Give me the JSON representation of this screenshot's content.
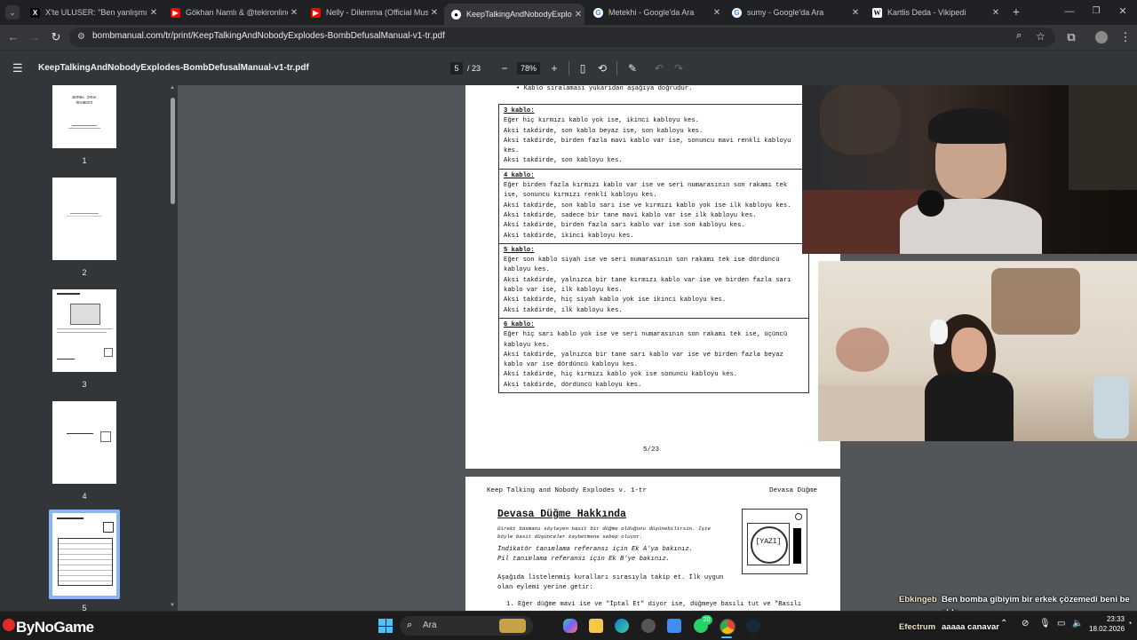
{
  "browser": {
    "tabs": [
      {
        "title": "X'te ULUSER: \"Ben yanlışmı duy",
        "icon": "x-icon",
        "active": false
      },
      {
        "title": "Gökhan Namlı & @tekironline",
        "icon": "youtube-icon",
        "active": false
      },
      {
        "title": "Nelly - Dilemma (Official Music",
        "icon": "youtube-icon",
        "active": false
      },
      {
        "title": "KeepTalkingAndNobodyExplod",
        "icon": "bombmanual-icon",
        "active": true
      },
      {
        "title": "Metekhi - Google'da Ara",
        "icon": "google-icon",
        "active": false
      },
      {
        "title": "sumy - Google'da Ara",
        "icon": "google-icon",
        "active": false
      },
      {
        "title": "Kartlis Deda - Vikipedi",
        "icon": "wikipedia-icon",
        "active": false
      }
    ],
    "url": "bombmanual.com/tr/print/KeepTalkingAndNobodyExplodes-BombDefusalManual-v1-tr.pdf"
  },
  "pdf": {
    "filename": "KeepTalkingAndNobodyExplodes-BombDefusalManual-v1-tr.pdf",
    "current_page": "5",
    "total_pages": "/ 23",
    "zoom": "78%",
    "thumbnails": [
      {
        "num": "1",
        "title": "BOMBA İMHA\nREHBERİ"
      },
      {
        "num": "2"
      },
      {
        "num": "3"
      },
      {
        "num": "4"
      },
      {
        "num": "5",
        "selected": true
      }
    ]
  },
  "page5": {
    "intro_bullet": "Kablo sıralaması yukarıdan aşağıya doğrudur.",
    "sections": [
      {
        "head": "3 kablo:",
        "lines": [
          "Eğer hiç kırmızı kablo yok ise, ikinci kabloyu kes.",
          "Aksi takdirde, son kablo beyaz ise, son kabloyu kes.",
          "Aksi takdirde, birden fazla mavi kablo var ise, sonuncu mavi renkli kabloyu kes.",
          "Aksi takdirde, son kabloyu kes."
        ]
      },
      {
        "head": "4 kablo:",
        "lines": [
          "Eğer birden fazla kırmızı kablo var ise ve seri numarasının son rakamı tek ise, sonuncu kırmızı renkli kabloyu kes.",
          "Aksi takdirde, son kablo sarı ise ve kırmızı kablo yok ise ilk kabloyu kes.",
          "Aksi takdirde, sadece bir tane mavi kablo var ise ilk kabloyu kes.",
          "Aksi takdirde, birden fazla sarı kablo var ise son kabloyu kes.",
          "Aksi takdirde, ikinci kabloyu kes."
        ]
      },
      {
        "head": "5 kablo:",
        "lines": [
          "Eğer son kablo siyah ise ve seri numarasının son rakamı tek ise dördüncü kabloyu kes.",
          "Aksi takdirde, yalnızca bir tane kırmızı kablo var ise ve birden fazla sarı kablo var ise, ilk kabloyu kes.",
          "Aksi takdirde, hiç siyah kablo yok ise ikinci kabloyu kes.",
          "Aksi takdirde, ilk kabloyu kes."
        ]
      },
      {
        "head": "6 kablo:",
        "lines": [
          "Eğer hiç sarı kablo yok ise ve seri numarasının son rakamı tek ise, üçüncü kabloyu kes.",
          "Aksi takdirde, yalnızca bir tane sarı kablo var ise ve birden fazla beyaz kablo var ise dördüncü kabloyu kes.",
          "Aksi takdirde, hiç kırmızı kablo yok ise sonuncu kabloyu kes.",
          "Aksi takdirde, dördüncü kabloyu kes."
        ]
      }
    ],
    "page_number": "5/23"
  },
  "page6": {
    "header_left": "Keep Talking and Nobody Explodes v. 1-tr",
    "header_right": "Devasa Düğme",
    "title": "Devasa Düğme Hakkında",
    "italic_intro": "Direkt basmanı söyleyen basit bir düğme olduğunu düşünebilirsin. İşte böyle basit düşünceler kaybetmene sebep oluyor.",
    "ref1": "İndikatör tanımlama referansı için Ek A'ya bakınız.",
    "ref2": "Pil tanımlama referansı için Ek B'ye bakınız.",
    "instruction": "Aşağıda listelenmiş kuralları sırasıyla takip et. İlk uygun olan eylemi yerine getir:",
    "rule1": "1. Eğer düğme mavi ise ve \"İptal Et\" diyor ise, düğmeye basılı tut ve \"Basılı",
    "button_label": "[YAZI]"
  },
  "chat": [
    {
      "user": "Ebkingeb",
      "message": "Ben bomba gibiyim bir erkek çözemedi beni be",
      "message2": "abla"
    },
    {
      "user": "Efectrum",
      "message": "aaaaa canavar"
    }
  ],
  "overlay": {
    "brand": "ByNoGame"
  },
  "taskbar": {
    "search_placeholder": "Ara",
    "whatsapp_badge": "20",
    "time": "23:33",
    "date": "18.02.2026"
  }
}
